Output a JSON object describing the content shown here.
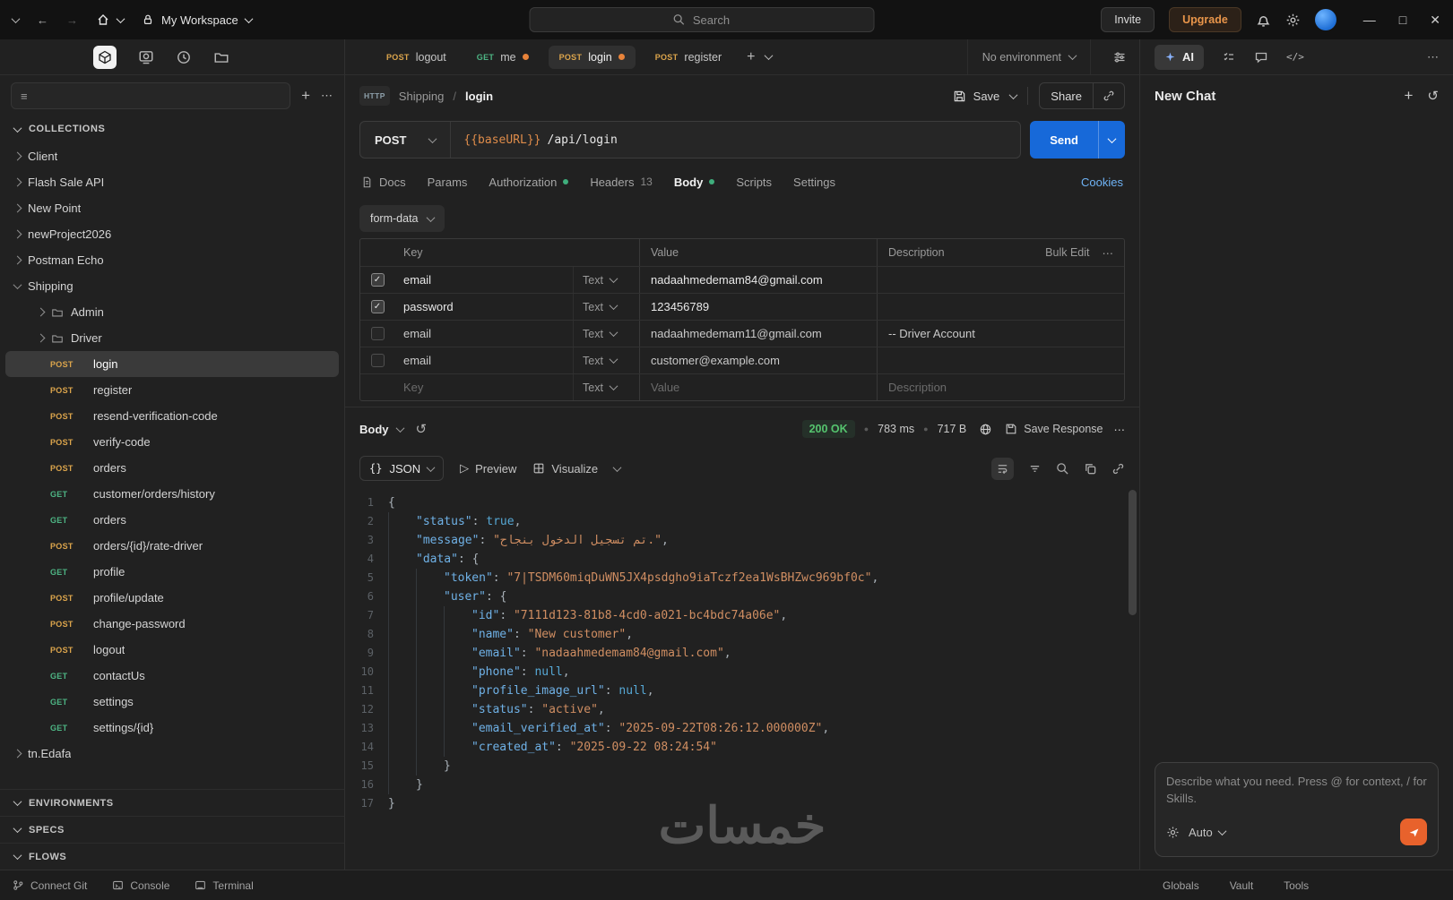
{
  "titlebar": {
    "workspace": "My Workspace",
    "search_placeholder": "Search",
    "invite_label": "Invite",
    "upgrade_label": "Upgrade"
  },
  "editor_tabs": {
    "items": [
      {
        "method": "POST",
        "label": "logout",
        "modified": false,
        "active": false
      },
      {
        "method": "GET",
        "label": "me",
        "modified": true,
        "active": false
      },
      {
        "method": "POST",
        "label": "login",
        "modified": true,
        "active": true
      },
      {
        "method": "POST",
        "label": "register",
        "modified": false,
        "active": false
      }
    ],
    "environment_selector": "No environment"
  },
  "sidebar": {
    "collections_header": "COLLECTIONS",
    "tree": [
      {
        "kind": "collection",
        "label": "Client"
      },
      {
        "kind": "collection",
        "label": "Flash Sale API"
      },
      {
        "kind": "collection",
        "label": "New Point"
      },
      {
        "kind": "collection",
        "label": "newProject2026"
      },
      {
        "kind": "collection",
        "label": "Postman Echo"
      },
      {
        "kind": "collection",
        "label": "Shipping",
        "expanded": true
      },
      {
        "kind": "folder",
        "label": "Admin"
      },
      {
        "kind": "folder",
        "label": "Driver"
      },
      {
        "kind": "request",
        "method": "POST",
        "label": "login",
        "selected": true
      },
      {
        "kind": "request",
        "method": "POST",
        "label": "register"
      },
      {
        "kind": "request",
        "method": "POST",
        "label": "resend-verification-code"
      },
      {
        "kind": "request",
        "method": "POST",
        "label": "verify-code"
      },
      {
        "kind": "request",
        "method": "POST",
        "label": "orders"
      },
      {
        "kind": "request",
        "method": "GET",
        "label": "customer/orders/history"
      },
      {
        "kind": "request",
        "method": "GET",
        "label": "orders"
      },
      {
        "kind": "request",
        "method": "POST",
        "label": "orders/{id}/rate-driver"
      },
      {
        "kind": "request",
        "method": "GET",
        "label": "profile"
      },
      {
        "kind": "request",
        "method": "POST",
        "label": "profile/update"
      },
      {
        "kind": "request",
        "method": "POST",
        "label": "change-password"
      },
      {
        "kind": "request",
        "method": "POST",
        "label": "logout"
      },
      {
        "kind": "request",
        "method": "GET",
        "label": "contactUs"
      },
      {
        "kind": "request",
        "method": "GET",
        "label": "settings"
      },
      {
        "kind": "request",
        "method": "GET",
        "label": "settings/{id}"
      },
      {
        "kind": "collection",
        "label": "tn.Edafa"
      }
    ],
    "bottom_sections": [
      "ENVIRONMENTS",
      "SPECS",
      "FLOWS"
    ]
  },
  "request": {
    "protocol_badge": "HTTP",
    "breadcrumb": [
      "Shipping",
      "login"
    ],
    "save_label": "Save",
    "share_label": "Share",
    "method": "POST",
    "url_variable": "{{baseURL}}",
    "url_path": "/api/login",
    "send_label": "Send",
    "tabs": [
      {
        "label": "Docs",
        "icon": true
      },
      {
        "label": "Params"
      },
      {
        "label": "Authorization",
        "dot": "green"
      },
      {
        "label": "Headers",
        "badge": "13"
      },
      {
        "label": "Body",
        "dot": "green",
        "active": true
      },
      {
        "label": "Scripts"
      },
      {
        "label": "Settings"
      }
    ],
    "cookies_link": "Cookies",
    "body_type": "form-data",
    "kv_table": {
      "columns": [
        "Key",
        "Value",
        "Description"
      ],
      "bulk_edit_label": "Bulk Edit",
      "type_label": "Text",
      "rows": [
        {
          "checked": true,
          "key": "email",
          "value": "nadaahmedemam84@gmail.com",
          "description": ""
        },
        {
          "checked": true,
          "key": "password",
          "value": "123456789",
          "description": ""
        },
        {
          "checked": false,
          "key": "email",
          "value": "nadaahmedemam11@gmail.com",
          "description": "-- Driver Account"
        },
        {
          "checked": false,
          "key": "email",
          "value": "customer@example.com",
          "description": ""
        }
      ],
      "placeholder_row": {
        "key": "Key",
        "value": "Value",
        "description": "Description"
      }
    }
  },
  "response": {
    "body_selector": "Body",
    "status": "200 OK",
    "time": "783 ms",
    "size": "717 B",
    "save_response_label": "Save Response",
    "format_selector": "JSON",
    "preview_label": "Preview",
    "visualize_label": "Visualize",
    "code_lines": [
      {
        "n": 1,
        "i": 0,
        "s": [
          [
            "{",
            "p"
          ]
        ]
      },
      {
        "n": 2,
        "i": 1,
        "s": [
          [
            "\"status\"",
            "k"
          ],
          [
            ": ",
            "p"
          ],
          [
            "true",
            "b"
          ],
          [
            ",",
            "p"
          ]
        ]
      },
      {
        "n": 3,
        "i": 1,
        "s": [
          [
            "\"message\"",
            "k"
          ],
          [
            ": ",
            "p"
          ],
          [
            "\"",
            "s"
          ],
          [
            "تم تسجيل الدخول بنجاح.",
            "s"
          ],
          [
            "\"",
            "s"
          ],
          [
            ",",
            "p"
          ]
        ]
      },
      {
        "n": 4,
        "i": 1,
        "s": [
          [
            "\"data\"",
            "k"
          ],
          [
            ": ",
            "p"
          ],
          [
            "{",
            "p"
          ]
        ]
      },
      {
        "n": 5,
        "i": 2,
        "s": [
          [
            "\"token\"",
            "k"
          ],
          [
            ": ",
            "p"
          ],
          [
            "\"7|TSDM60miqDuWN5JX4psdgho9iaTczf2ea1WsBHZwc969bf0c\"",
            "s"
          ],
          [
            ",",
            "p"
          ]
        ]
      },
      {
        "n": 6,
        "i": 2,
        "s": [
          [
            "\"user\"",
            "k"
          ],
          [
            ": ",
            "p"
          ],
          [
            "{",
            "p"
          ]
        ]
      },
      {
        "n": 7,
        "i": 3,
        "s": [
          [
            "\"id\"",
            "k"
          ],
          [
            ": ",
            "p"
          ],
          [
            "\"7111d123-81b8-4cd0-a021-bc4bdc74a06e\"",
            "s"
          ],
          [
            ",",
            "p"
          ]
        ]
      },
      {
        "n": 8,
        "i": 3,
        "s": [
          [
            "\"name\"",
            "k"
          ],
          [
            ": ",
            "p"
          ],
          [
            "\"New customer\"",
            "s"
          ],
          [
            ",",
            "p"
          ]
        ]
      },
      {
        "n": 9,
        "i": 3,
        "s": [
          [
            "\"email\"",
            "k"
          ],
          [
            ": ",
            "p"
          ],
          [
            "\"nadaahmedemam84@gmail.com\"",
            "s"
          ],
          [
            ",",
            "p"
          ]
        ]
      },
      {
        "n": 10,
        "i": 3,
        "s": [
          [
            "\"phone\"",
            "k"
          ],
          [
            ": ",
            "p"
          ],
          [
            "null",
            "b"
          ],
          [
            ",",
            "p"
          ]
        ]
      },
      {
        "n": 11,
        "i": 3,
        "s": [
          [
            "\"profile_image_url\"",
            "k"
          ],
          [
            ": ",
            "p"
          ],
          [
            "null",
            "b"
          ],
          [
            ",",
            "p"
          ]
        ]
      },
      {
        "n": 12,
        "i": 3,
        "s": [
          [
            "\"status\"",
            "k"
          ],
          [
            ": ",
            "p"
          ],
          [
            "\"active\"",
            "s"
          ],
          [
            ",",
            "p"
          ]
        ]
      },
      {
        "n": 13,
        "i": 3,
        "s": [
          [
            "\"email_verified_at\"",
            "k"
          ],
          [
            ": ",
            "p"
          ],
          [
            "\"2025-09-22T08:26:12.000000Z\"",
            "s"
          ],
          [
            ",",
            "p"
          ]
        ]
      },
      {
        "n": 14,
        "i": 3,
        "s": [
          [
            "\"created_at\"",
            "k"
          ],
          [
            ": ",
            "p"
          ],
          [
            "\"2025-09-22 08:24:54\"",
            "s"
          ]
        ]
      },
      {
        "n": 15,
        "i": 2,
        "s": [
          [
            "}",
            "p"
          ]
        ]
      },
      {
        "n": 16,
        "i": 1,
        "s": [
          [
            "}",
            "p"
          ]
        ]
      },
      {
        "n": 17,
        "i": 0,
        "s": [
          [
            "}",
            "p"
          ]
        ]
      }
    ]
  },
  "ai_panel": {
    "ai_button": "AI",
    "title": "New Chat",
    "input_placeholder": "Describe what you need. Press @ for context, / for Skills.",
    "mode_selector": "Auto"
  },
  "statusbar": {
    "left": [
      "Connect Git",
      "Console",
      "Terminal"
    ],
    "right": [
      "Globals",
      "Vault",
      "Tools"
    ]
  },
  "watermark": "خمسات",
  "colors": {
    "post": "#dca54c",
    "get": "#4db584",
    "accent_blue": "#1769d9",
    "success_green": "#55c46e",
    "unsaved_dot": "#e8833a"
  }
}
